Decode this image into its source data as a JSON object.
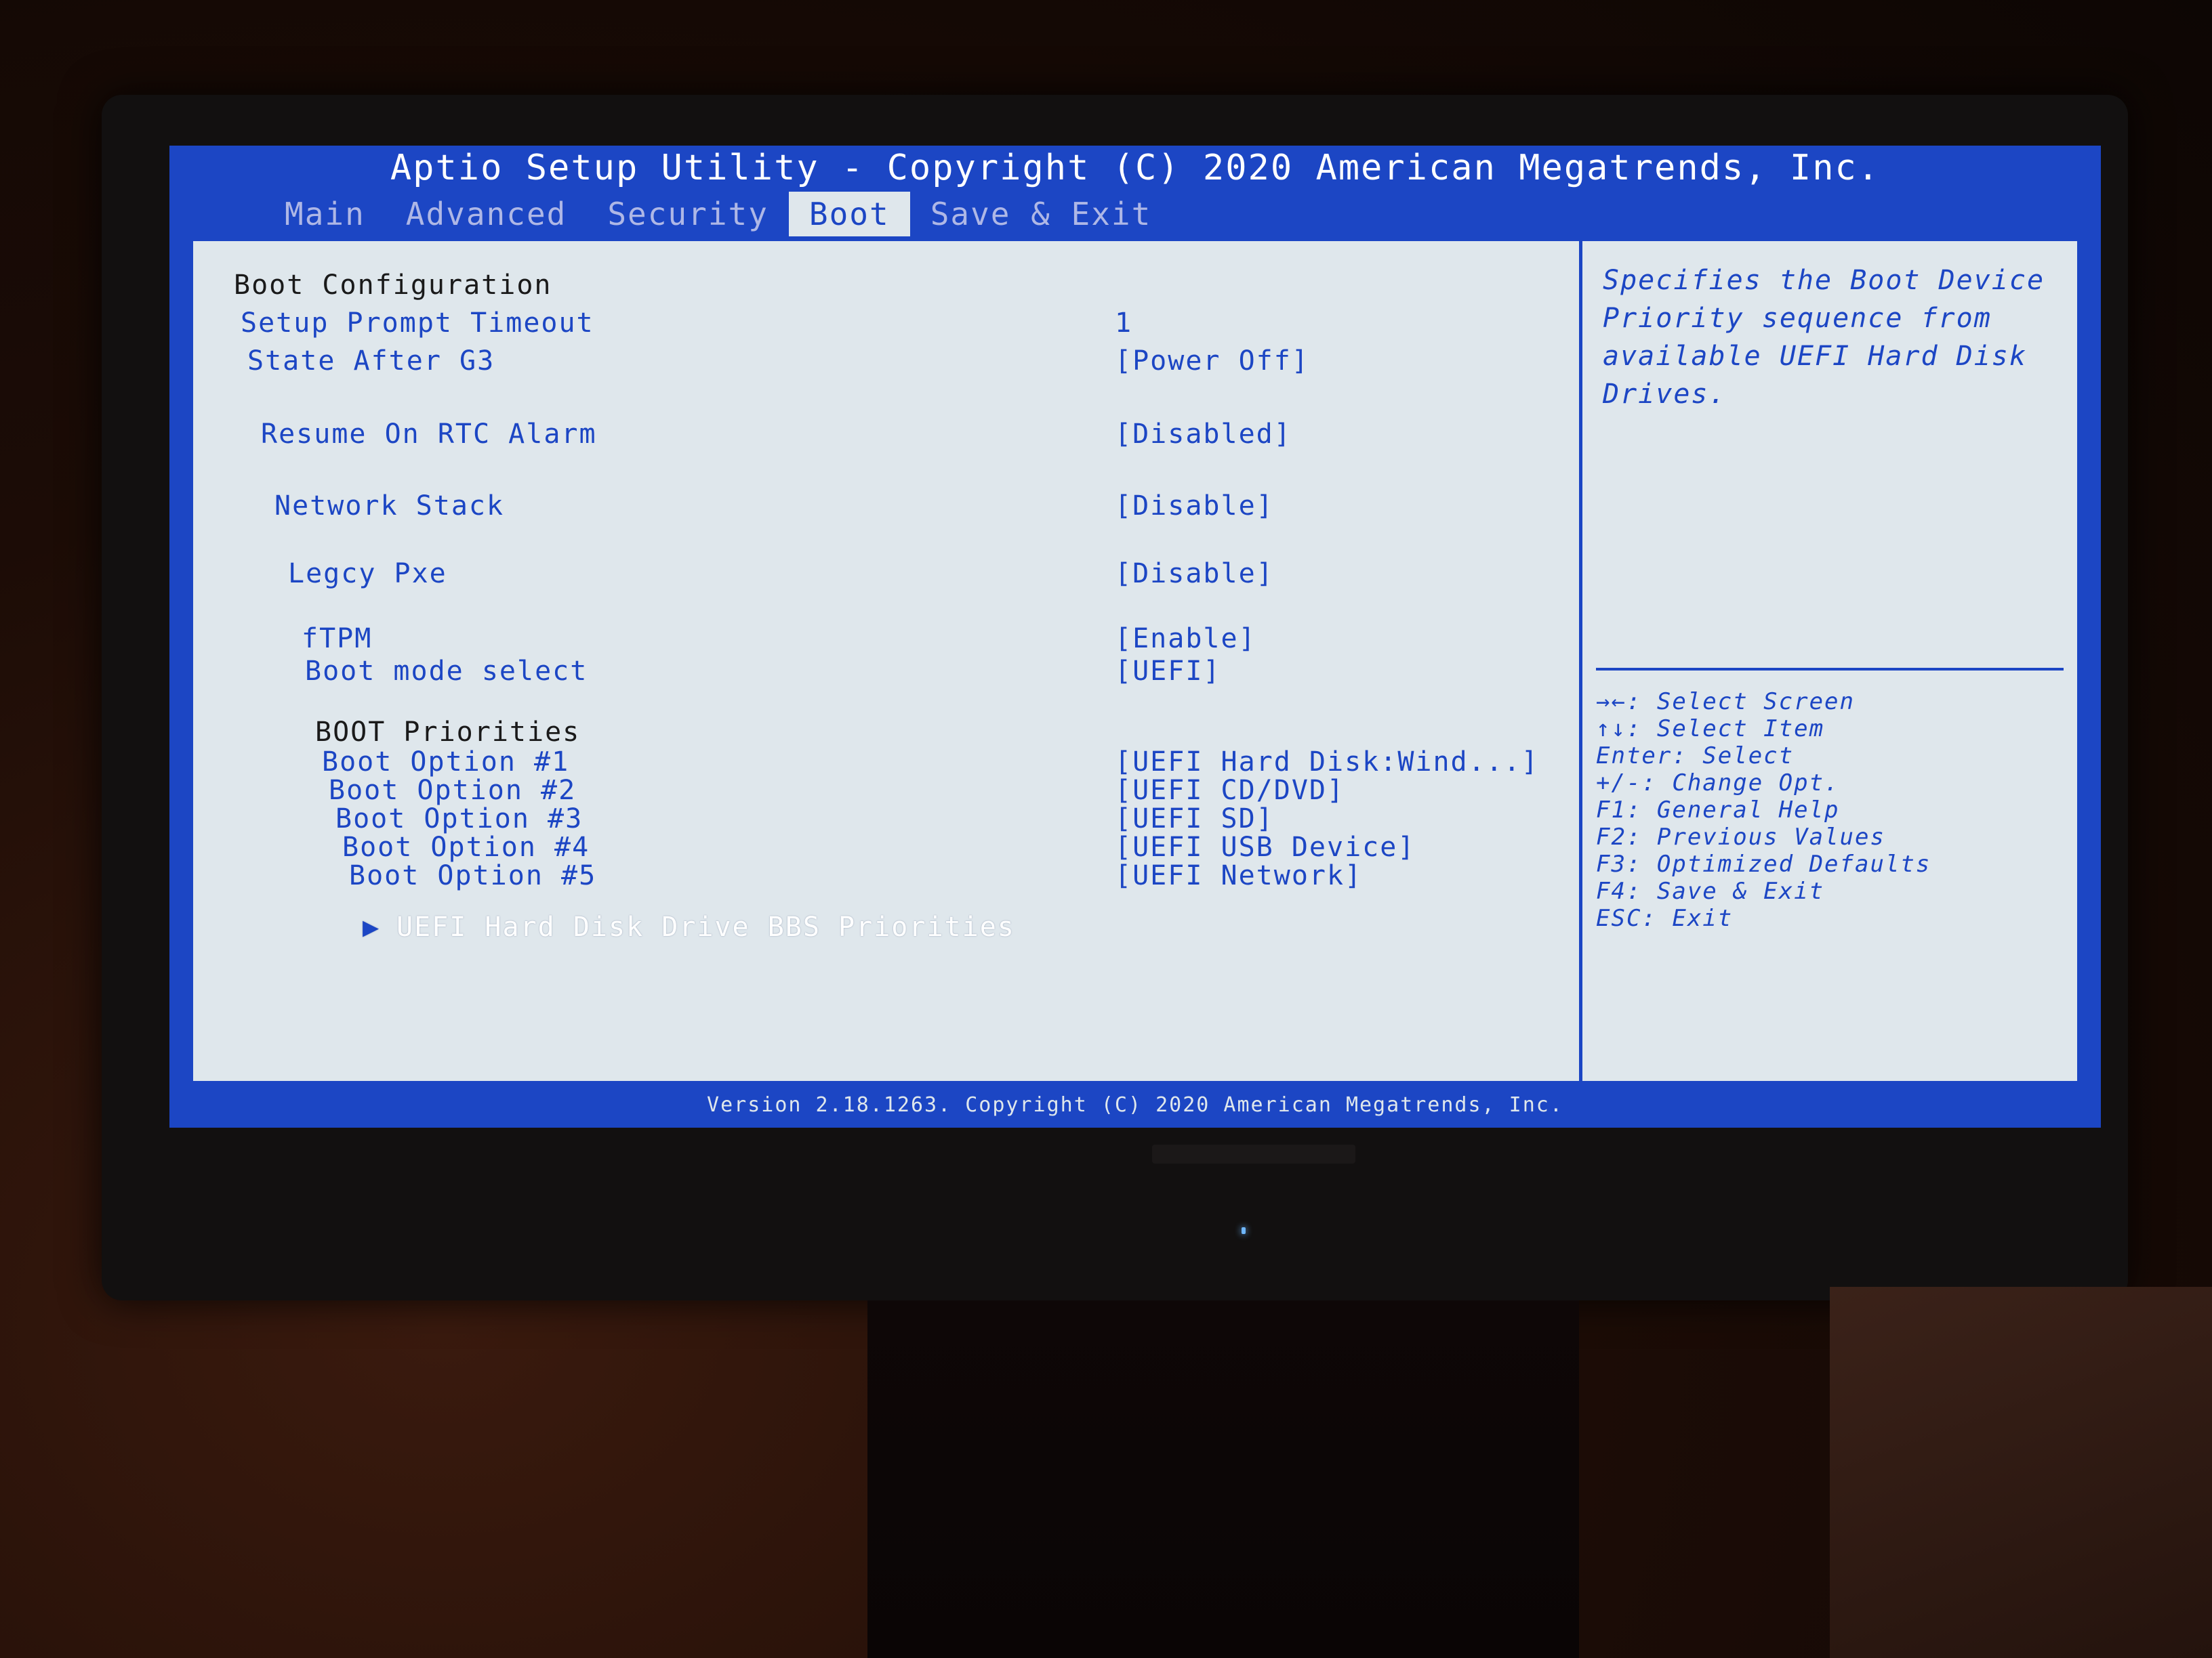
{
  "header": {
    "title": "Aptio Setup Utility - Copyright (C) 2020 American Megatrends, Inc."
  },
  "tabs": [
    {
      "label": "Main"
    },
    {
      "label": "Advanced"
    },
    {
      "label": "Security"
    },
    {
      "label": "Boot",
      "active": true
    },
    {
      "label": "Save & Exit"
    }
  ],
  "boot": {
    "section_title": "Boot Configuration",
    "items": [
      {
        "label": "Setup Prompt Timeout",
        "value": "1"
      },
      {
        "label": "State After G3",
        "value": "[Power Off]"
      },
      {
        "label": "Resume On RTC Alarm",
        "value": "[Disabled]"
      },
      {
        "label": "Network Stack",
        "value": "[Disable]"
      },
      {
        "label": "Legcy Pxe",
        "value": "[Disable]"
      },
      {
        "label": "fTPM",
        "value": "[Enable]"
      },
      {
        "label": "Boot mode select",
        "value": "[UEFI]"
      }
    ],
    "priorities_title": "BOOT Priorities",
    "options": [
      {
        "label": "Boot Option #1",
        "value": "[UEFI Hard Disk:Wind...]"
      },
      {
        "label": "Boot Option #2",
        "value": "[UEFI CD/DVD]"
      },
      {
        "label": "Boot Option #3",
        "value": "[UEFI SD]"
      },
      {
        "label": "Boot Option #4",
        "value": "[UEFI USB Device]"
      },
      {
        "label": "Boot Option #5",
        "value": "[UEFI Network]"
      }
    ],
    "submenu_arrow": "▶",
    "submenu": "UEFI Hard Disk Drive BBS Priorities"
  },
  "help": {
    "text": "Specifies the Boot Device Priority sequence from available UEFI Hard Disk Drives."
  },
  "keys": [
    "→←: Select Screen",
    "↑↓: Select Item",
    "Enter: Select",
    "+/-: Change Opt.",
    "F1: General Help",
    "F2: Previous Values",
    "F3: Optimized Defaults",
    "F4: Save & Exit",
    "ESC: Exit"
  ],
  "footer": {
    "text": "Version 2.18.1263. Copyright (C) 2020 American Megatrends, Inc."
  },
  "colors": {
    "bios_blue": "#1c46c4",
    "panel_bg": "#dfe7ec",
    "text_white": "#ffffff"
  }
}
